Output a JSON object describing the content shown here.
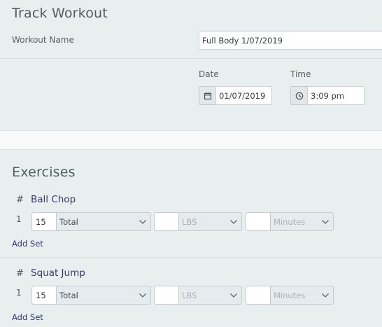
{
  "header": {
    "title": "Track Workout"
  },
  "workout_name": {
    "label": "Workout Name",
    "value": "Full Body 1/07/2019"
  },
  "date": {
    "label": "Date",
    "value": "01/07/2019",
    "icon": "calendar-icon"
  },
  "time": {
    "label": "Time",
    "value": "3:09 pm",
    "icon": "clock-icon"
  },
  "exercises": {
    "title": "Exercises",
    "items": [
      {
        "hash": "#",
        "name": "Ball Chop",
        "set_number": "1",
        "reps_value": "15",
        "reps_unit": "Total",
        "weight_unit": "LBS",
        "duration_unit": "Minutes",
        "add_set_label": "Add Set"
      },
      {
        "hash": "#",
        "name": "Squat Jump",
        "set_number": "1",
        "reps_value": "15",
        "reps_unit": "Total",
        "weight_unit": "LBS",
        "duration_unit": "Minutes",
        "add_set_label": "Add Set"
      }
    ]
  },
  "colors": {
    "background": "#e9eeee",
    "link": "#33367a",
    "exercise_name": "#38386e"
  }
}
